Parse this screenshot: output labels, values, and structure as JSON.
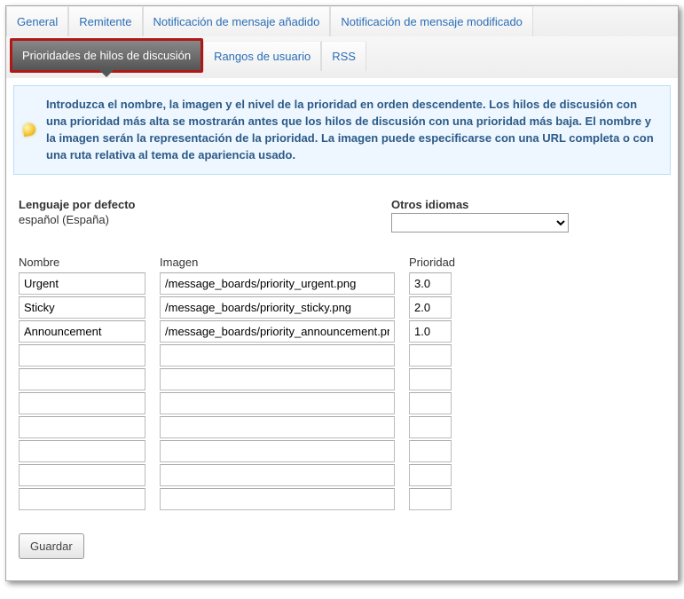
{
  "tabs": {
    "row1": [
      {
        "id": "general",
        "label": "General",
        "active": false
      },
      {
        "id": "remitente",
        "label": "Remitente",
        "active": false
      },
      {
        "id": "notif_add",
        "label": "Notificación de mensaje añadido",
        "active": false
      },
      {
        "id": "notif_mod",
        "label": "Notificación de mensaje modificado",
        "active": false
      }
    ],
    "row2": [
      {
        "id": "priorities",
        "label": "Prioridades de hilos de discusión",
        "active": true,
        "highlighted": true
      },
      {
        "id": "rangos",
        "label": "Rangos de usuario",
        "active": false
      },
      {
        "id": "rss",
        "label": "RSS",
        "active": false
      }
    ]
  },
  "info": {
    "text": "Introduzca el nombre, la imagen y el nivel de la prioridad en orden descendente. Los hilos de discusión con una prioridad más alta se mostrarán antes que los hilos de discusión con una prioridad más baja. El nombre y la imagen serán la representación de la prioridad. La imagen puede especificarse con una URL completa o con una ruta relativa al tema de apariencia usado."
  },
  "language": {
    "default_label": "Lenguaje por defecto",
    "default_value": "español (España)",
    "other_label": "Otros idiomas",
    "other_selected": ""
  },
  "columns": {
    "name_header": "Nombre",
    "image_header": "Imagen",
    "priority_header": "Prioridad"
  },
  "rows": [
    {
      "name": "Urgent",
      "image": "/message_boards/priority_urgent.png",
      "priority": "3.0"
    },
    {
      "name": "Sticky",
      "image": "/message_boards/priority_sticky.png",
      "priority": "2.0"
    },
    {
      "name": "Announcement",
      "image": "/message_boards/priority_announcement.png",
      "priority": "1.0"
    },
    {
      "name": "",
      "image": "",
      "priority": ""
    },
    {
      "name": "",
      "image": "",
      "priority": ""
    },
    {
      "name": "",
      "image": "",
      "priority": ""
    },
    {
      "name": "",
      "image": "",
      "priority": ""
    },
    {
      "name": "",
      "image": "",
      "priority": ""
    },
    {
      "name": "",
      "image": "",
      "priority": ""
    },
    {
      "name": "",
      "image": "",
      "priority": ""
    }
  ],
  "buttons": {
    "save": "Guardar"
  }
}
